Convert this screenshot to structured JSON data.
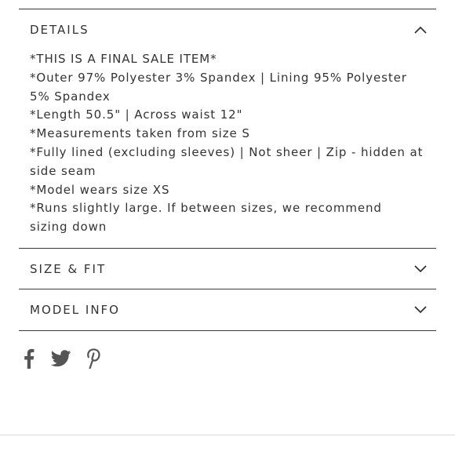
{
  "details": {
    "title": "DETAILS",
    "expanded": true,
    "lines": [
      "*THIS IS A FINAL SALE ITEM*",
      "*Outer 97% Polyester 3% Spandex | Lining 95% Polyester",
      "5% Spandex",
      "*Length 50.5\" | Across waist 12\"",
      "*Measurements taken from size S",
      "*Fully lined (excluding sleeves) | Not sheer | Zip - hidden at",
      "side seam",
      "*Model wears size XS",
      "*Runs slightly large. If between sizes, we recommend",
      "sizing down"
    ]
  },
  "size_fit": {
    "title": "SIZE & FIT",
    "expanded": false
  },
  "model_info": {
    "title": "MODEL INFO",
    "expanded": false
  },
  "icons": {
    "details_toggle": "chevron-up-icon",
    "size_fit_toggle": "chevron-down-icon",
    "model_info_toggle": "chevron-down-icon",
    "share": [
      "facebook-icon",
      "twitter-icon",
      "pinterest-icon"
    ]
  },
  "colors": {
    "text": "#333333",
    "rule": "#3a3a3a",
    "icon": "#555555"
  }
}
